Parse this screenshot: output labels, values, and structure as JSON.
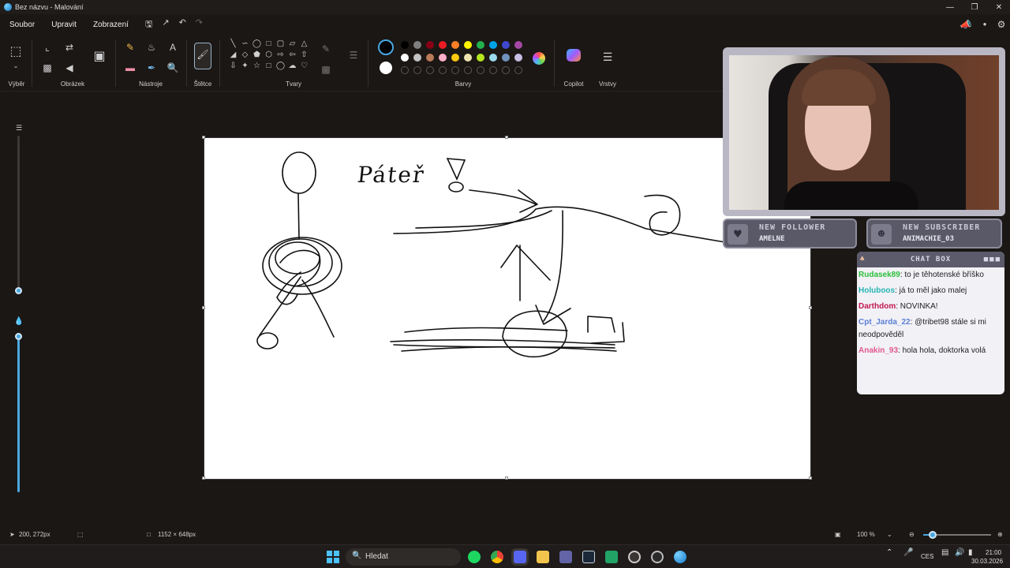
{
  "window": {
    "title": "Bez názvu - Malování"
  },
  "menu": {
    "items": [
      "Soubor",
      "Upravit",
      "Zobrazení"
    ]
  },
  "ribbon": {
    "groups": [
      "Výběr",
      "Obrázek",
      "Nástroje",
      "Štětce",
      "Tvary",
      "Barvy",
      "Copilot",
      "Vrstvy"
    ]
  },
  "colors": {
    "palette_row1": [
      "#000000",
      "#7f7f7f",
      "#880015",
      "#ed1c24",
      "#ff7f27",
      "#fff200",
      "#22b14c",
      "#00a2e8",
      "#3f48cc",
      "#a349a4"
    ],
    "palette_row2": [
      "#ffffff",
      "#c3c3c3",
      "#b97a57",
      "#ffaec9",
      "#ffc90e",
      "#efe4b0",
      "#b5e61d",
      "#99d9ea",
      "#7092be",
      "#c8bfe7"
    ],
    "accent": "#4aa7e0"
  },
  "stream": {
    "follower_label": "NEW FOLLOWER",
    "follower_name": "AMELNE",
    "subscriber_label": "NEW SUBSCRIBER",
    "subscriber_name": "ANIMACHIE_03",
    "chat_title": "CHAT BOX",
    "chat": [
      {
        "user": "Rudasek89",
        "color": "#2bbf3a",
        "text": ": to je těhotenské bříško"
      },
      {
        "user": "Holuboos",
        "color": "#26b5b5",
        "text": ": já to měl jako malej"
      },
      {
        "user": "Darthdom",
        "color": "#c0184f",
        "text": ": NOVINKA!"
      },
      {
        "user": "Cpt_Jarda_22",
        "color": "#5a7fd6",
        "text": ": @tribet98 stále si mi neodpověděl"
      },
      {
        "user": "Anakin_93",
        "color": "#e0588f",
        "text": ": hola hola, doktorka volá"
      }
    ]
  },
  "status": {
    "cursor": "200, 272px",
    "canvas_size": "1152 × 648px",
    "zoom": "100 %"
  },
  "taskbar": {
    "search_placeholder": "Hledat",
    "lang": "CES",
    "time": "21:00",
    "date": "30.03.2026"
  },
  "drawing": {
    "text": "Páteř"
  }
}
